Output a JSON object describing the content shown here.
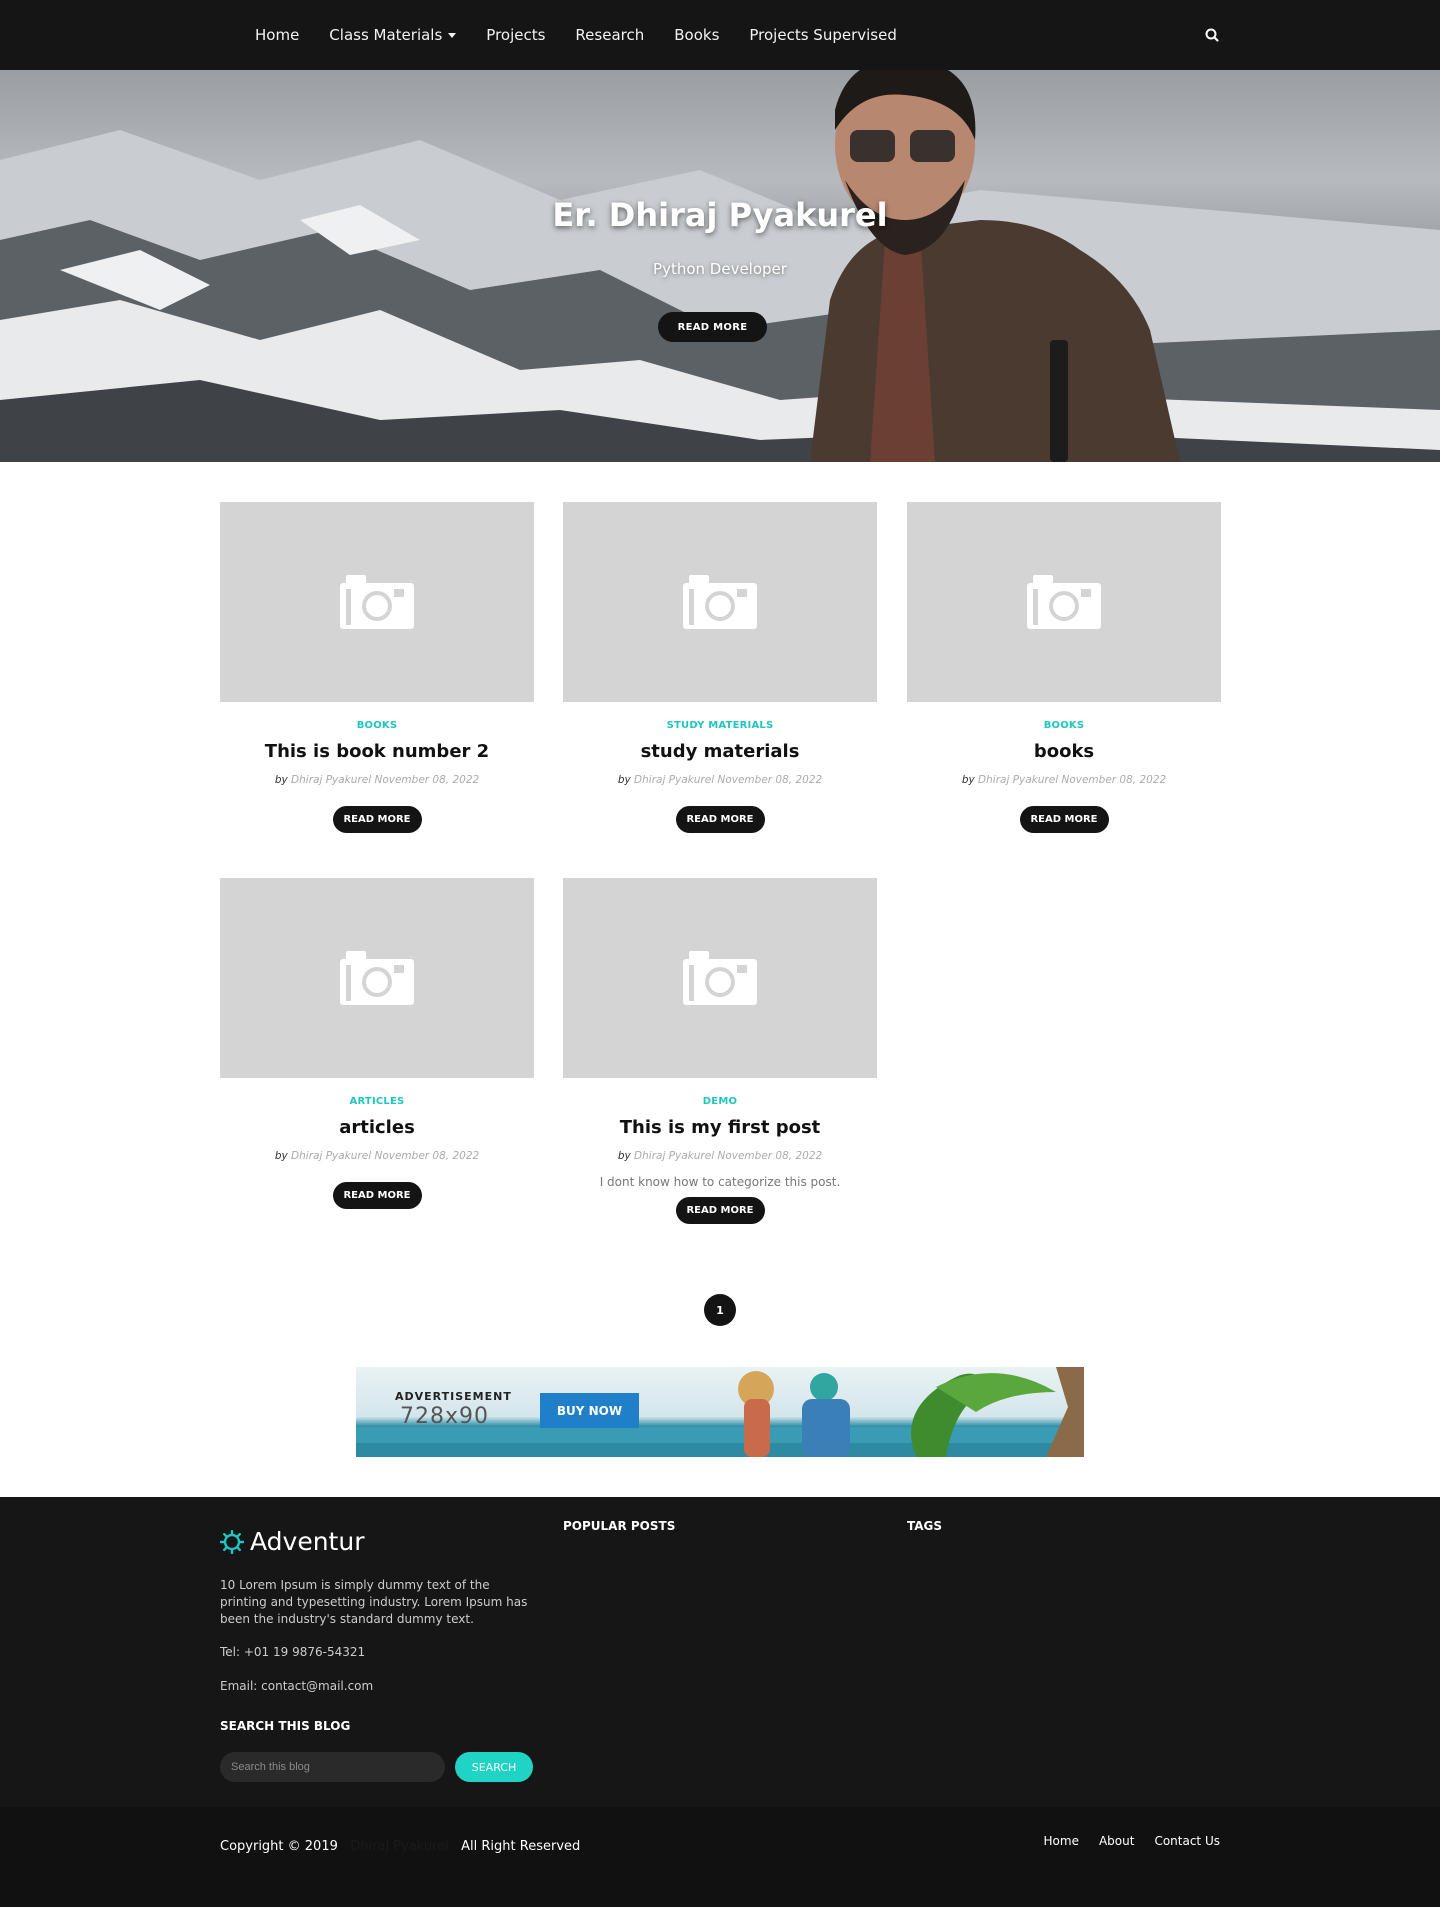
{
  "nav": {
    "items": [
      {
        "label": "Home"
      },
      {
        "label": "Class Materials"
      },
      {
        "label": "Projects"
      },
      {
        "label": "Research"
      },
      {
        "label": "Books"
      },
      {
        "label": "Projects Supervised"
      }
    ]
  },
  "hero": {
    "title": "Er. Dhiraj Pyakurel",
    "subtitle": "Python Developer",
    "button": "READ MORE"
  },
  "posts": [
    {
      "category": "BOOKS",
      "title": "This is book number 2",
      "by": "by",
      "author": "Dhiraj Pyakurel",
      "date": "November 08, 2022",
      "excerpt": "",
      "button": "READ MORE"
    },
    {
      "category": "STUDY MATERIALS",
      "title": "study materials",
      "by": "by",
      "author": "Dhiraj Pyakurel",
      "date": "November 08, 2022",
      "excerpt": "",
      "button": "READ MORE"
    },
    {
      "category": "BOOKS",
      "title": "books",
      "by": "by",
      "author": "Dhiraj Pyakurel",
      "date": "November 08, 2022",
      "excerpt": "",
      "button": "READ MORE"
    },
    {
      "category": "ARTICLES",
      "title": "articles",
      "by": "by",
      "author": "Dhiraj Pyakurel",
      "date": "November 08, 2022",
      "excerpt": "",
      "button": "READ MORE"
    },
    {
      "category": "DEMO",
      "title": "This is my first post",
      "by": "by",
      "author": "Dhiraj Pyakurel",
      "date": "November 08, 2022",
      "excerpt": "I dont know how to categorize this post.",
      "button": "READ MORE"
    }
  ],
  "pagination": {
    "current": "1"
  },
  "ad": {
    "label": "ADVERTISEMENT",
    "size": "728x90",
    "button": "BUY NOW"
  },
  "footer": {
    "logo": "Adventur",
    "about": "10 Lorem Ipsum is simply dummy text of the printing and typesetting industry. Lorem Ipsum has been the industry's standard dummy text.",
    "tel": "Tel: +01 19 9876-54321",
    "email": "Email: contact@mail.com",
    "search_heading": "SEARCH THIS BLOG",
    "search_placeholder": "Search this blog",
    "search_button": "SEARCH",
    "popular_heading": "POPULAR POSTS",
    "tags_heading": "TAGS"
  },
  "bottom": {
    "copyright_pre": "Copyright © 2019",
    "copyright_site": "Dhiraj Pyakurel",
    "copyright_post": "All Right Reserved",
    "links": [
      {
        "label": "Home"
      },
      {
        "label": "About"
      },
      {
        "label": "Contact Us"
      }
    ]
  },
  "colors": {
    "accent": "#1dc6c1",
    "dark": "#151515",
    "button": "#141414",
    "ad_button": "#1f7fc9"
  }
}
